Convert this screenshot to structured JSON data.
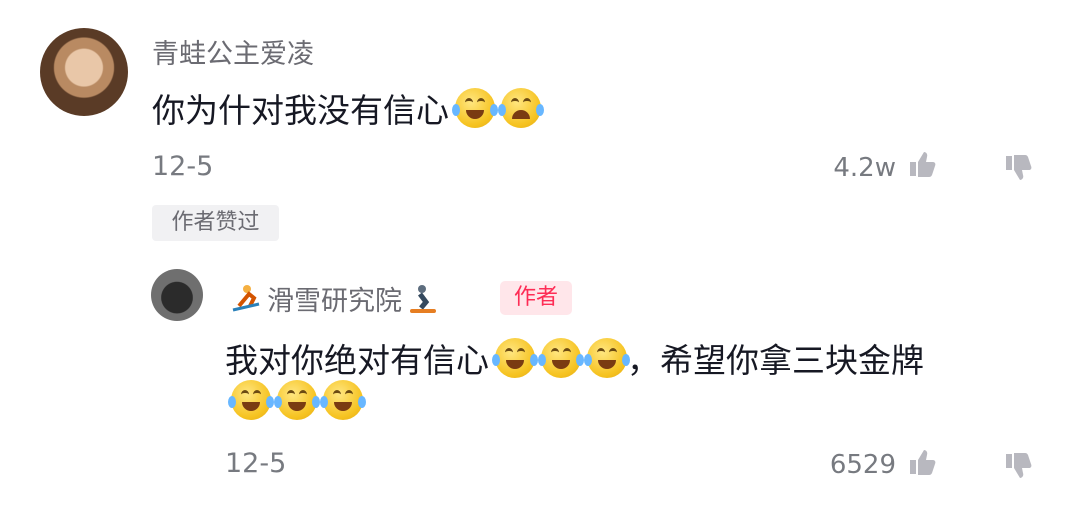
{
  "comment": {
    "username": "青蛙公主爱凌",
    "text": "你为什对我没有信心",
    "emojis": [
      "laughing-tears-emoji",
      "crying-emoji"
    ],
    "date": "12-5",
    "like_count": "4.2w",
    "liked_by_author_label": "作者赞过"
  },
  "reply": {
    "username": "滑雪研究院",
    "author_badge": "作者",
    "text_line1": "我对你绝对有信心",
    "text_line1_tail": "，希望你拿三块金牌",
    "emojis_line1": [
      "tearful-smile-emoji",
      "tearful-smile-emoji",
      "tearful-smile-emoji"
    ],
    "emojis_line2": [
      "rolling-laughing-emoji",
      "rolling-laughing-emoji",
      "rolling-laughing-emoji"
    ],
    "date": "12-5",
    "like_count": "6529",
    "username_icons": [
      "skier-icon",
      "snowboarder-icon"
    ]
  },
  "colors": {
    "accent": "#fe2c55",
    "username": "#6b6b72",
    "meta": "#777a80"
  }
}
